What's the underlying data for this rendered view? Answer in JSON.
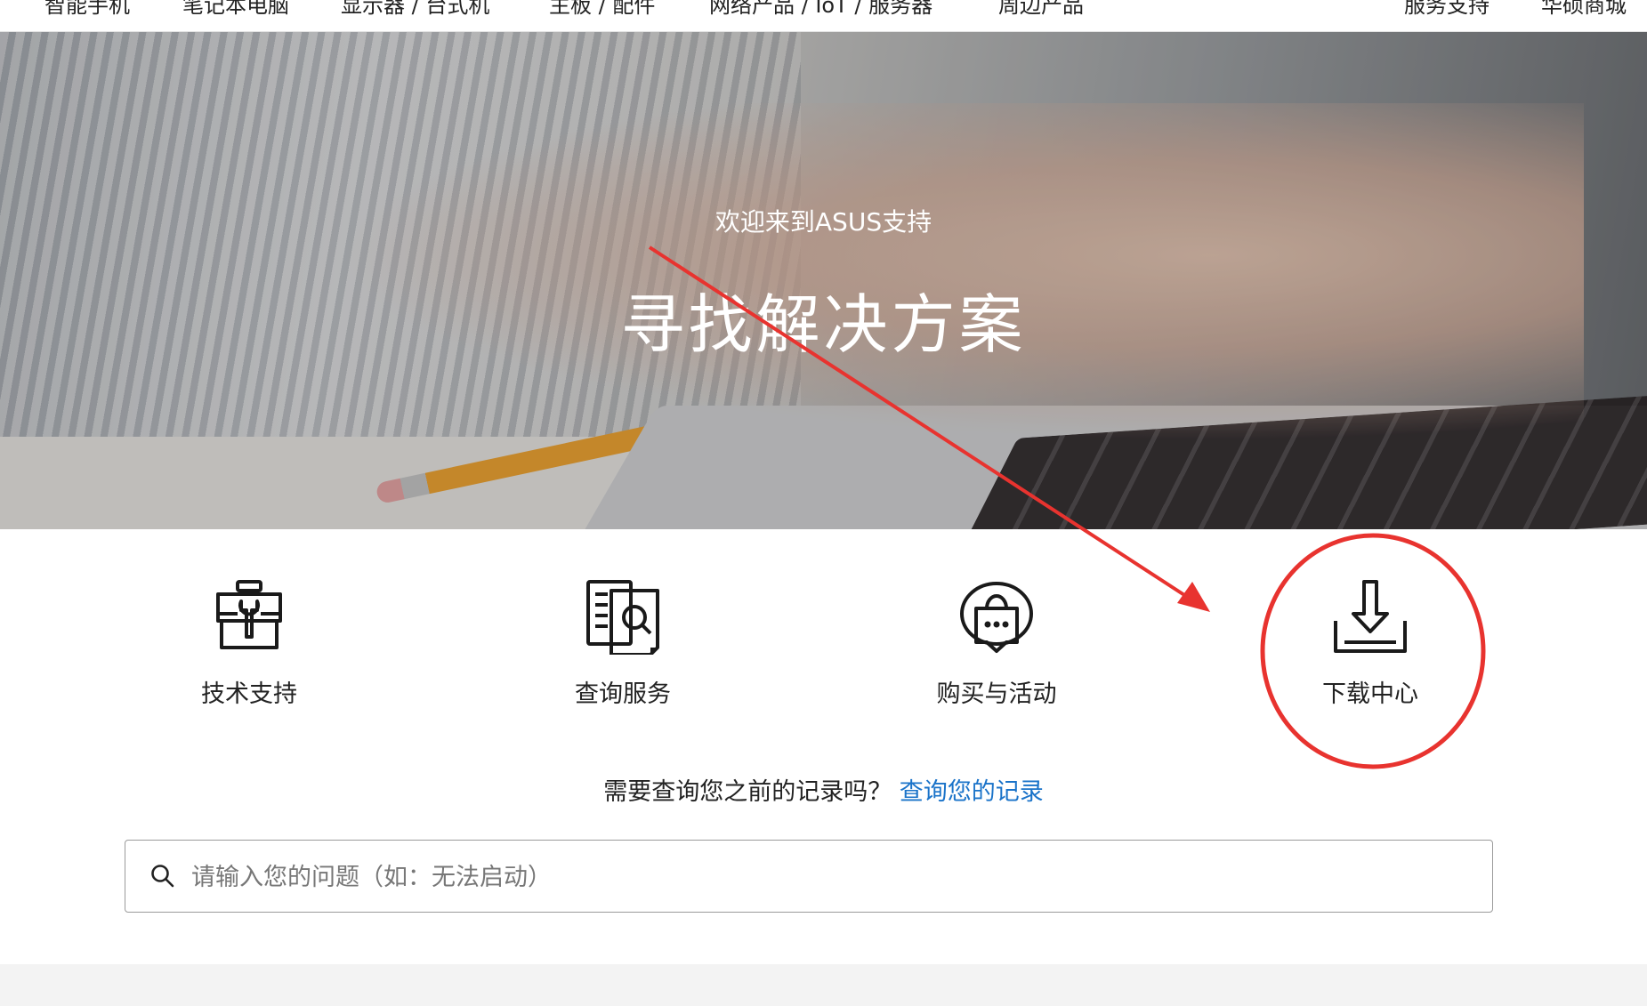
{
  "nav": {
    "items": [
      "智能手机",
      "笔记本电脑",
      "显示器 / 台式机",
      "主板 / 配件",
      "网络产品 / IoT / 服务器",
      "周边产品",
      "服务支持",
      "华硕商城"
    ]
  },
  "hero": {
    "welcome": "欢迎来到ASUS支持",
    "headline": "寻找解决方案"
  },
  "tiles": [
    {
      "label": "技术支持",
      "icon": "toolbox-icon"
    },
    {
      "label": "查询服务",
      "icon": "document-search-icon"
    },
    {
      "label": "购买与活动",
      "icon": "shopping-bag-chat-icon"
    },
    {
      "label": "下载中心",
      "icon": "download-icon"
    }
  ],
  "query": {
    "text": "需要查询您之前的记录吗？",
    "link": "查询您的记录"
  },
  "search": {
    "placeholder": "请输入您的问题（如：无法启动）"
  },
  "colors": {
    "link": "#1a73c9",
    "annotation": "#e8332f"
  }
}
